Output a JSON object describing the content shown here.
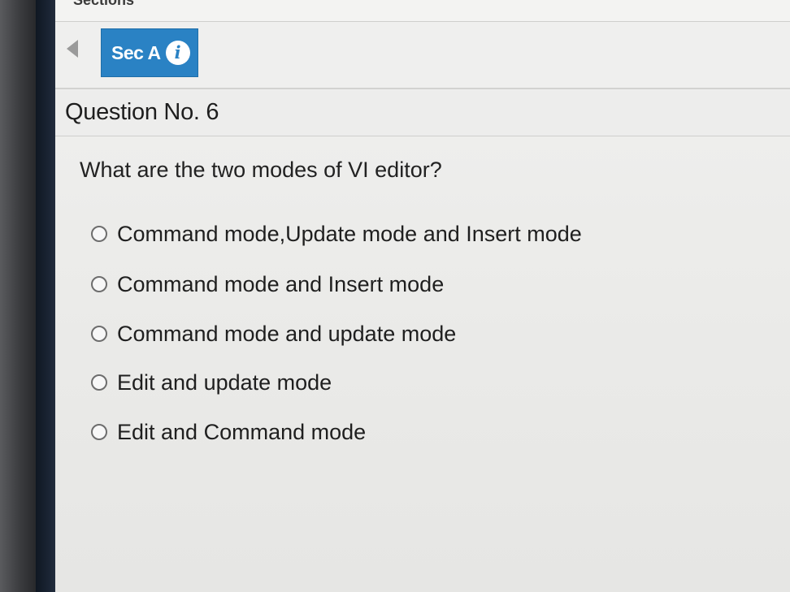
{
  "header": {
    "sections_label": "Sections"
  },
  "section_bar": {
    "tab_label": "Sec A",
    "info_glyph": "i"
  },
  "question": {
    "title": "Question No. 6",
    "text": "What are the two modes of VI editor?",
    "options": [
      "Command mode,Update mode and Insert mode",
      "Command mode and Insert mode",
      "Command mode and update mode",
      "Edit and update mode",
      "Edit and Command mode"
    ]
  },
  "icons": {
    "prev": "triangle-left-icon",
    "info": "info-icon",
    "radio": "radio-unchecked-icon"
  },
  "colors": {
    "accent": "#2a82c4",
    "background": "#ececea",
    "text": "#1f1f1f"
  }
}
